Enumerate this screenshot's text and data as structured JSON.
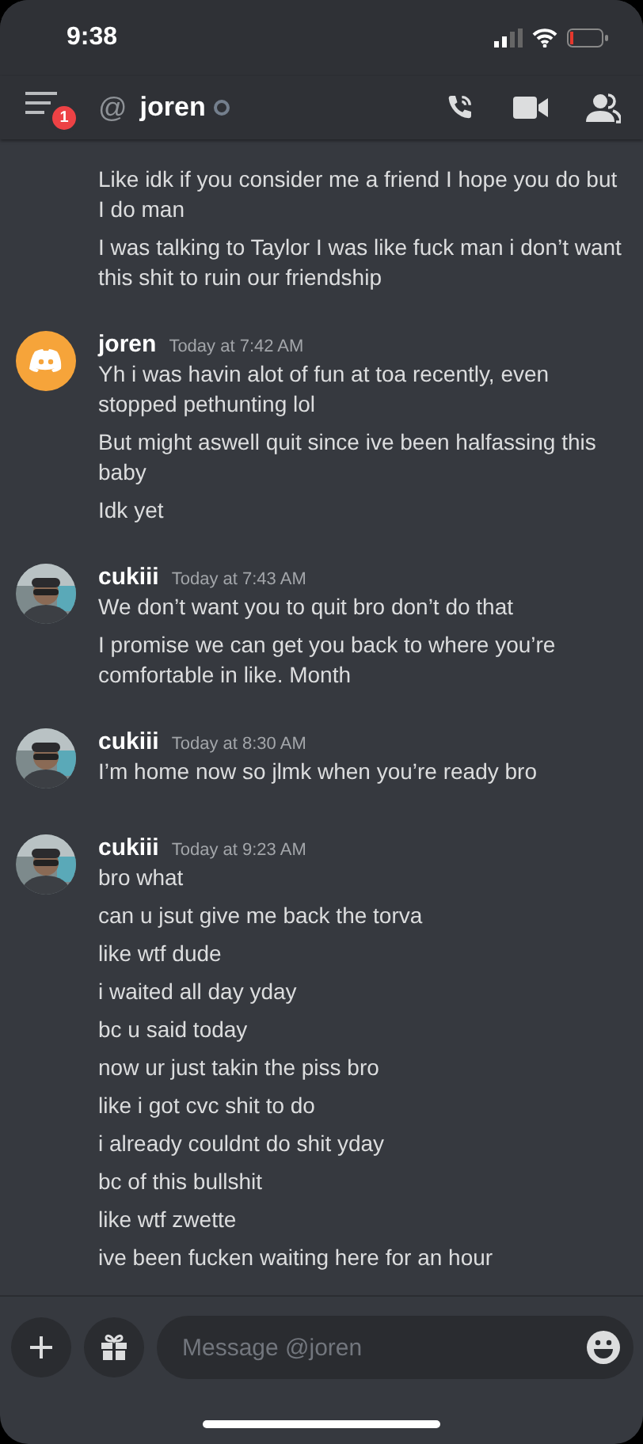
{
  "status_bar": {
    "time": "9:38"
  },
  "header": {
    "unread_count": "1",
    "at_sign": "@",
    "channel": "joren",
    "online": false
  },
  "messages": [
    {
      "kind": "continuation",
      "lines": [
        "Like idk if you consider me a friend I hope you do but I do man",
        "I was talking to Taylor I was like fuck man i don’t want this shit to ruin our friendship"
      ]
    },
    {
      "kind": "group",
      "avatar": {
        "kind": "logo"
      },
      "author": "joren",
      "time": "Today at 7:42 AM",
      "lines": [
        "Yh i was havin alot of fun at toa recently, even stopped pethunting lol",
        "But might aswell quit since ive been halfassing this baby",
        "Idk yet"
      ]
    },
    {
      "kind": "group",
      "avatar": {
        "kind": "picture"
      },
      "author": "cukiii",
      "time": "Today at 7:43 AM",
      "lines": [
        "We don’t want you to quit bro don’t do that",
        "I promise we can get you back to where you’re comfortable in like. Month"
      ]
    },
    {
      "kind": "group",
      "avatar": {
        "kind": "picture"
      },
      "author": "cukiii",
      "time": "Today at 8:30 AM",
      "lines": [
        "I’m home now so jlmk when you’re ready bro"
      ]
    },
    {
      "kind": "group",
      "avatar": {
        "kind": "picture"
      },
      "author": "cukiii",
      "time": "Today at 9:23 AM",
      "lines": [
        "bro what",
        "can u jsut give me back the torva",
        "like wtf dude",
        "i waited all day yday",
        "bc u said today",
        "now ur just takin the piss bro",
        "like i got cvc shit to do",
        "i already couldnt do shit yday",
        "bc of this bullshit",
        "like wtf zwette",
        "ive been fucken waiting here for an hour"
      ]
    }
  ],
  "composer": {
    "placeholder": "Message @joren"
  }
}
